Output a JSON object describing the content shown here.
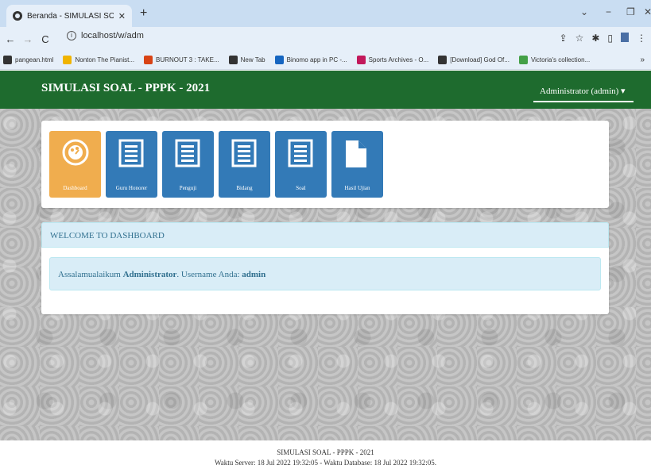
{
  "browser": {
    "tab_title": "Beranda - SIMULASI SOAL - PPP",
    "url": "localhost/w/adm",
    "bookmarks": [
      {
        "label": "pangean.html",
        "color": "#333333"
      },
      {
        "label": "Nonton The Pianist...",
        "color": "#f0b400"
      },
      {
        "label": "BURNOUT 3 : TAKE...",
        "color": "#d84315"
      },
      {
        "label": "New Tab",
        "color": "#333333"
      },
      {
        "label": "Binomo app in PC -...",
        "color": "#1565c0"
      },
      {
        "label": "Sports Archives - O...",
        "color": "#c2185b"
      },
      {
        "label": "[Download] God Of...",
        "color": "#333333"
      },
      {
        "label": "Victoria's collection...",
        "color": "#43a047"
      }
    ]
  },
  "app": {
    "brand": "SIMULASI SOAL - PPPK - 2021",
    "user_menu": "Administrator (admin)",
    "accent": "#1e6b2e"
  },
  "menu": [
    {
      "label": "Dashboard",
      "icon": "dashboard-icon",
      "active": true,
      "color": "#f0ad4e"
    },
    {
      "label": "Guru Honorer",
      "icon": "list-icon",
      "active": false,
      "color": "#337ab7"
    },
    {
      "label": "Penguji",
      "icon": "list-icon",
      "active": false,
      "color": "#337ab7"
    },
    {
      "label": "Bidang",
      "icon": "list-icon",
      "active": false,
      "color": "#337ab7"
    },
    {
      "label": "Soal",
      "icon": "list-icon",
      "active": false,
      "color": "#337ab7"
    },
    {
      "label": "Hasil Ujian",
      "icon": "file-icon",
      "active": false,
      "color": "#337ab7"
    }
  ],
  "dashboard": {
    "heading": "WELCOME TO DASHBOARD",
    "greeting_prefix": "Assalamualaikum",
    "name": "Administrator",
    "username_text": ". Username Anda:",
    "username": "admin"
  },
  "footer": {
    "line1": "SIMULASI SOAL - PPPK - 2021",
    "line2": "Waktu Server: 18 Jul 2022 19:32:05 - Waktu Database: 18 Jul 2022 19:32:05."
  }
}
